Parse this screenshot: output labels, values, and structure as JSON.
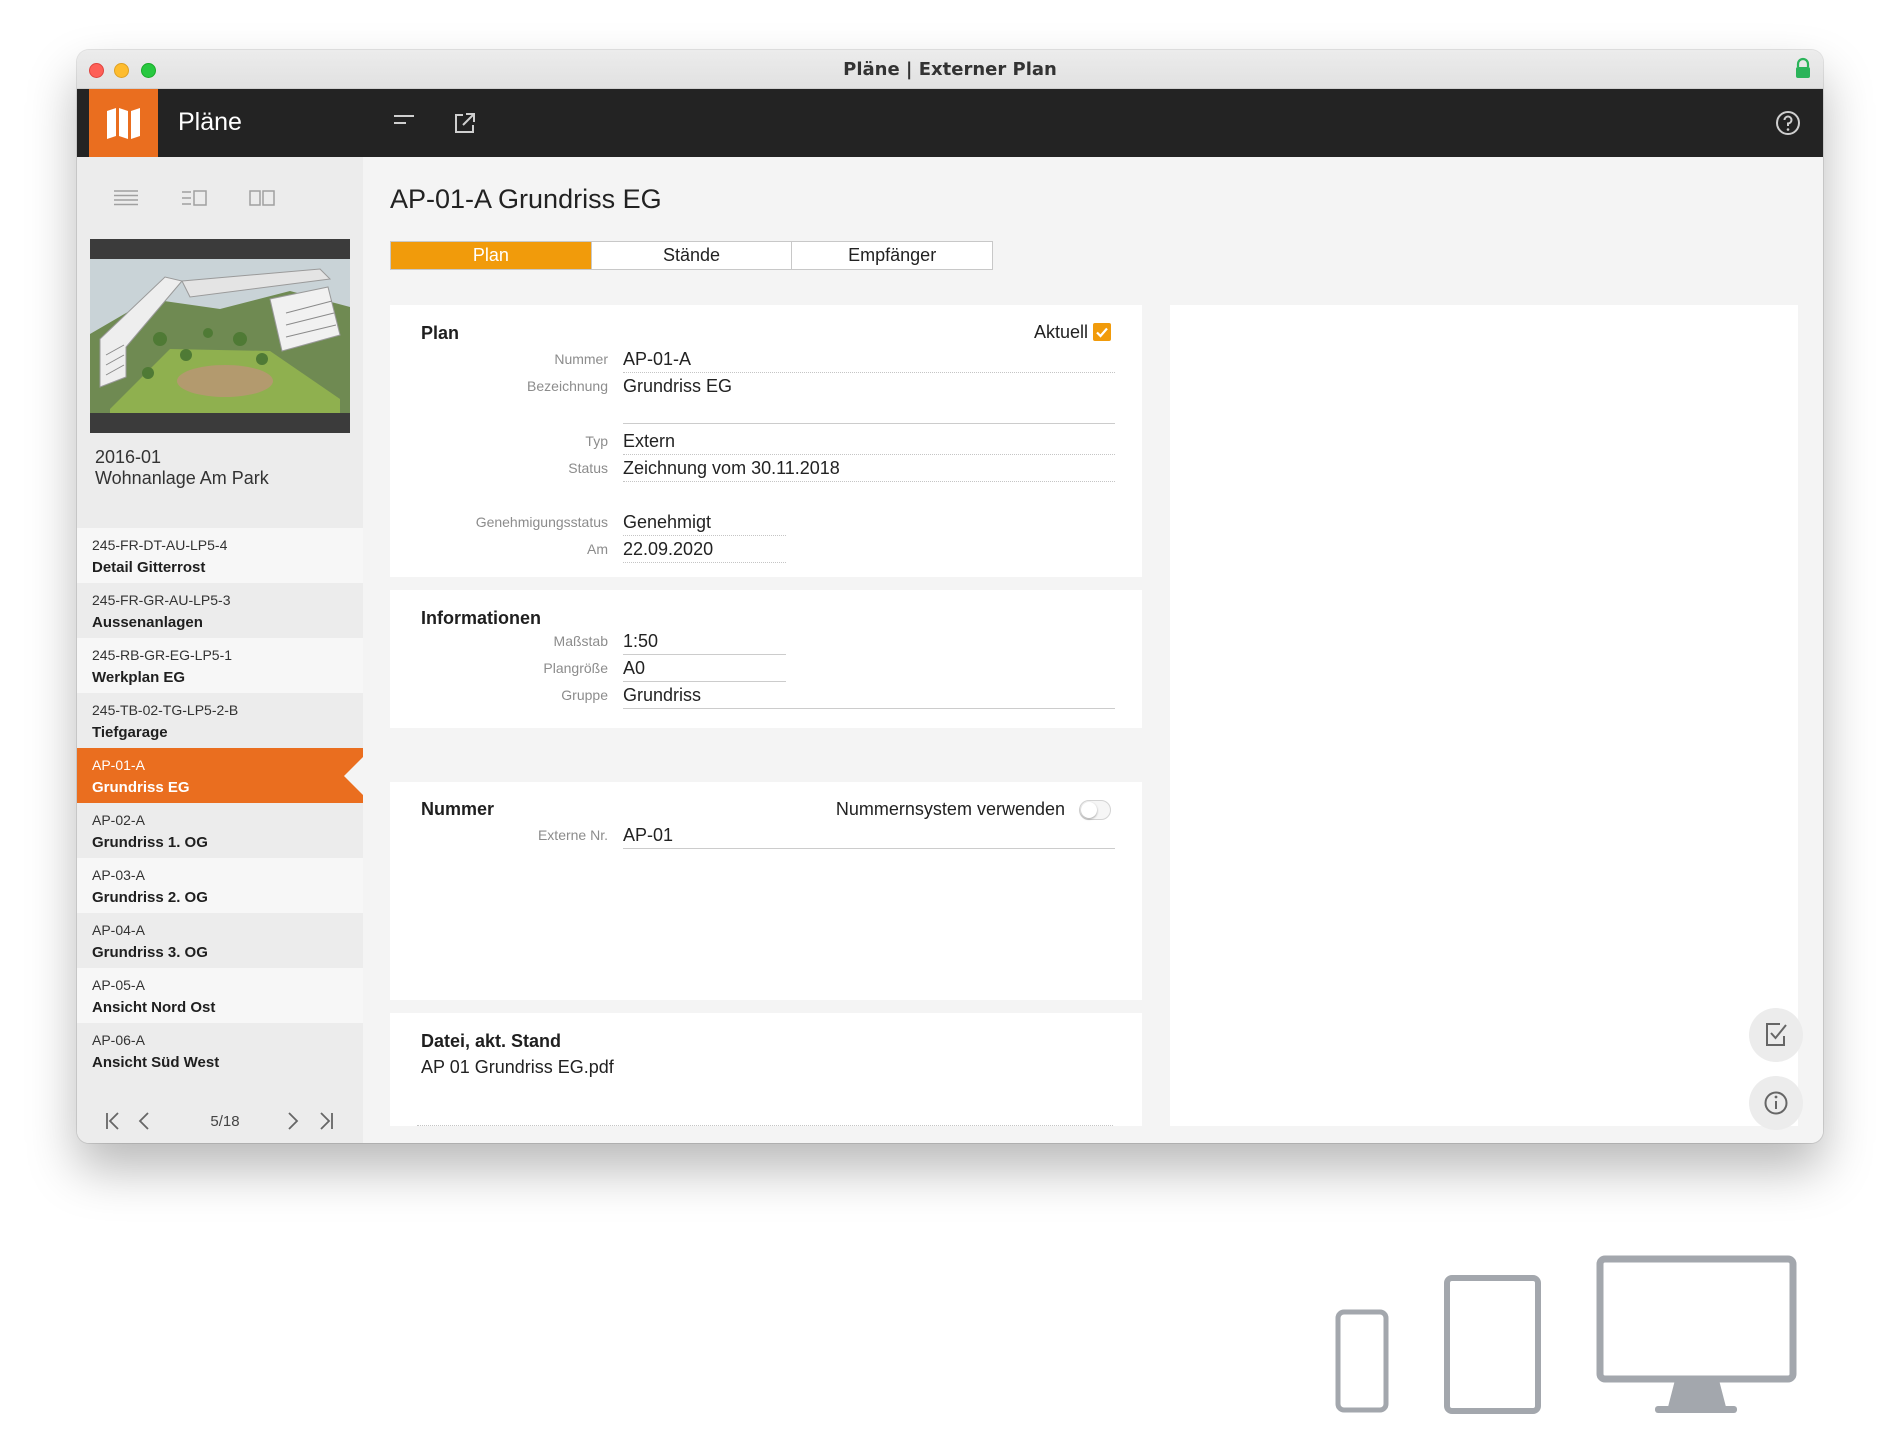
{
  "window": {
    "title": "Pläne | Externer Plan"
  },
  "app": {
    "name": "Pläne"
  },
  "project": {
    "code": "2016-01",
    "name": "Wohnanlage Am Park"
  },
  "plan_list": [
    {
      "code": "245-FR-DT-AU-LP5-4",
      "name": "Detail Gitterrost"
    },
    {
      "code": "245-FR-GR-AU-LP5-3",
      "name": "Aussenanlagen"
    },
    {
      "code": "245-RB-GR-EG-LP5-1",
      "name": "Werkplan EG"
    },
    {
      "code": "245-TB-02-TG-LP5-2-B",
      "name": "Tiefgarage"
    },
    {
      "code": "AP-01-A",
      "name": "Grundriss EG",
      "active": true
    },
    {
      "code": "AP-02-A",
      "name": "Grundriss 1. OG"
    },
    {
      "code": "AP-03-A",
      "name": "Grundriss 2. OG"
    },
    {
      "code": "AP-04-A",
      "name": "Grundriss 3. OG"
    },
    {
      "code": "AP-05-A",
      "name": "Ansicht Nord Ost"
    },
    {
      "code": "AP-06-A",
      "name": "Ansicht Süd West"
    }
  ],
  "pager": {
    "count": "5/18"
  },
  "detail": {
    "title": "AP-01-A Grundriss EG",
    "tabs": [
      {
        "label": "Plan",
        "active": true
      },
      {
        "label": "Stände"
      },
      {
        "label": "Empfänger"
      }
    ],
    "plan_section": {
      "title": "Plan",
      "aktuell_label": "Aktuell",
      "aktuell_checked": true,
      "fields": {
        "nummer": {
          "label": "Nummer",
          "value": "AP-01-A"
        },
        "bezeichnung": {
          "label": "Bezeichnung",
          "value": "Grundriss EG"
        },
        "typ": {
          "label": "Typ",
          "value": "Extern"
        },
        "status": {
          "label": "Status",
          "value": "Zeichnung vom 30.11.2018"
        },
        "genehmigungsstatus": {
          "label": "Genehmigungsstatus",
          "value": "Genehmigt"
        },
        "am": {
          "label": "Am",
          "value": "22.09.2020"
        }
      }
    },
    "info_section": {
      "title": "Informationen",
      "fields": {
        "massstab": {
          "label": "Maßstab",
          "value": "1:50"
        },
        "plangroesse": {
          "label": "Plangröße",
          "value": "A0"
        },
        "gruppe": {
          "label": "Gruppe",
          "value": "Grundriss"
        }
      }
    },
    "nummer_section": {
      "title": "Nummer",
      "switch_label": "Nummernsystem verwenden",
      "switch_on": false,
      "fields": {
        "externe_nr": {
          "label": "Externe Nr.",
          "value": "AP-01"
        }
      }
    },
    "file_section": {
      "title": "Datei, akt. Stand",
      "file_name": "AP 01 Grundriss EG.pdf"
    }
  },
  "colors": {
    "accent": "#ea6e1f",
    "tab_active": "#f19b0b",
    "appbar": "#232323"
  },
  "icons": {
    "appbar": [
      "map-icon",
      "menu-icon",
      "external-link-icon",
      "help-icon"
    ],
    "view_modes": [
      "list-view-icon",
      "list-preview-view-icon",
      "split-view-icon"
    ],
    "actions": [
      "checklist-icon",
      "info-icon"
    ],
    "devices": [
      "phone-icon",
      "tablet-icon",
      "desktop-icon"
    ]
  }
}
